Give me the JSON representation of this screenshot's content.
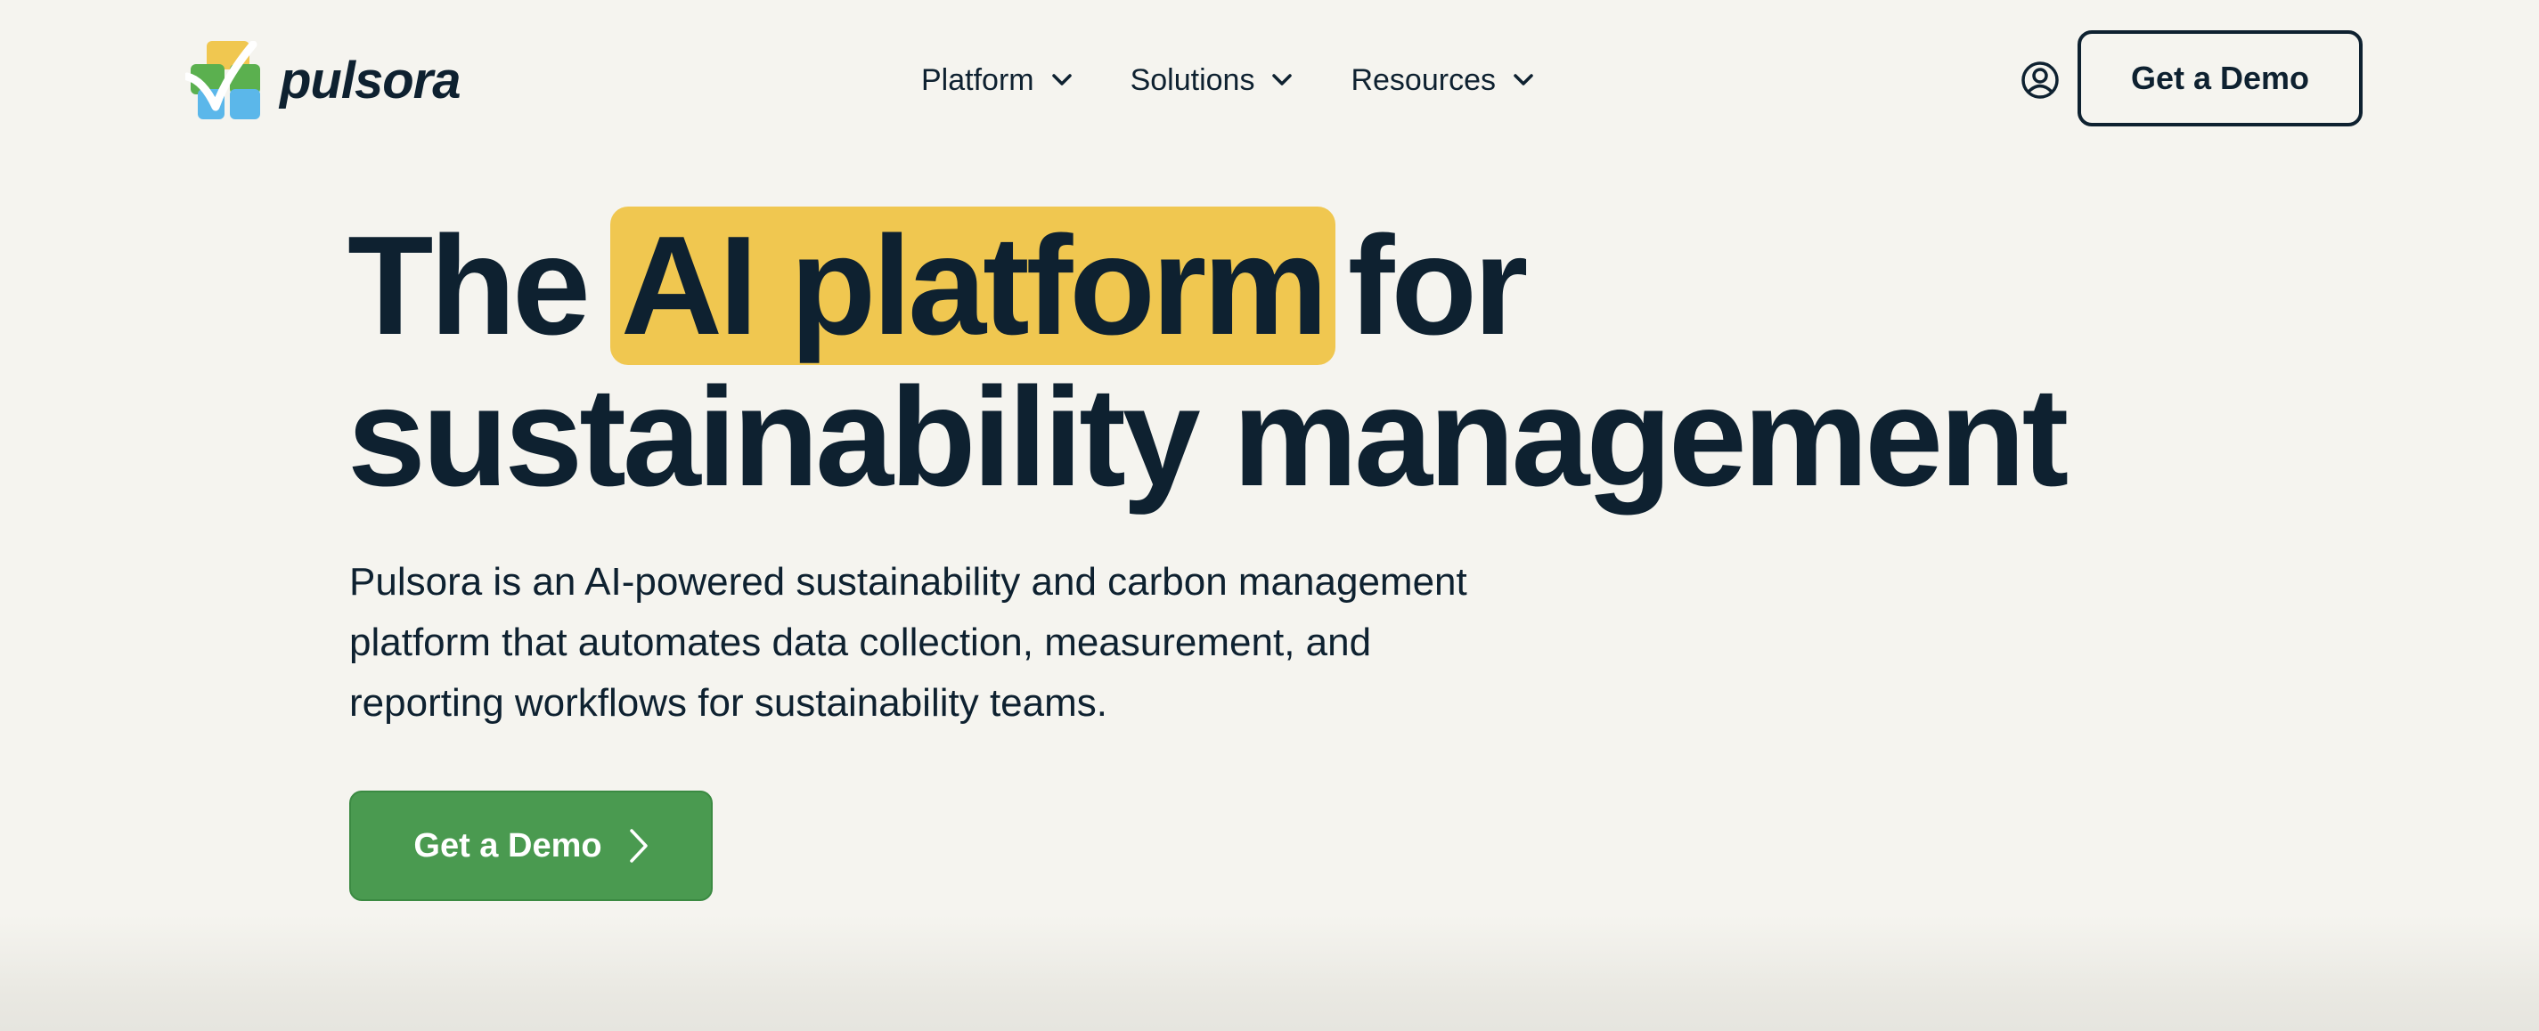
{
  "brand": {
    "name": "pulsora",
    "colors": {
      "yellow": "#f0c750",
      "green": "#5bb04f",
      "blue": "#5bb7ea",
      "navy": "#0e2130",
      "cta_green": "#4a9a50",
      "background": "#f5f4ef"
    }
  },
  "nav": {
    "items": [
      {
        "label": "Platform",
        "icon": "chevron-down-icon"
      },
      {
        "label": "Solutions",
        "icon": "chevron-down-icon"
      },
      {
        "label": "Resources",
        "icon": "chevron-down-icon"
      }
    ],
    "account_icon": "user-circle-icon",
    "cta_label": "Get a Demo"
  },
  "hero": {
    "headline_pre": "The",
    "headline_highlight": "AI platform",
    "headline_post": "for",
    "headline_line2": "sustainability management",
    "subtitle_lines": [
      "Pulsora is an AI-powered sustainability and carbon management",
      "platform that automates data collection, measurement, and",
      "reporting workflows for sustainability teams."
    ],
    "cta_label": "Get a Demo",
    "cta_icon": "chevron-right-icon"
  }
}
